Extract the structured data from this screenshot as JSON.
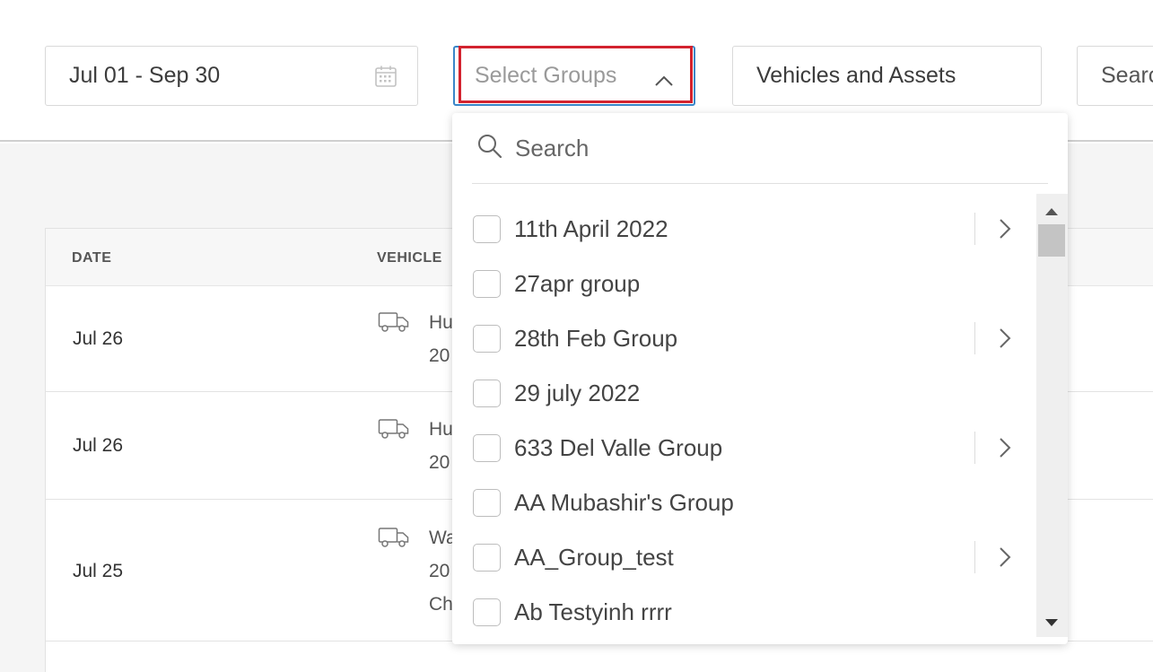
{
  "filters": {
    "date_range": "Jul 01 - Sep 30",
    "groups_placeholder": "Select Groups",
    "vehicles_placeholder": "Vehicles and Assets",
    "search_placeholder": "Search"
  },
  "table": {
    "headers": [
      "DATE",
      "VEHICLE"
    ],
    "rows": [
      {
        "date": "Jul 26",
        "vehicle_line1": "Hu",
        "vehicle_line2": "20",
        "vehicle_line3": ""
      },
      {
        "date": "Jul 26",
        "vehicle_line1": "Hu",
        "vehicle_line2": "20",
        "vehicle_line3": ""
      },
      {
        "date": "Jul 25",
        "vehicle_line1": "Wa",
        "vehicle_line2": "20",
        "vehicle_line3": "Ch"
      }
    ]
  },
  "dropdown": {
    "search_placeholder": "Search",
    "items": [
      {
        "label": "11th April 2022",
        "has_children": true
      },
      {
        "label": "27apr group",
        "has_children": false
      },
      {
        "label": "28th Feb Group",
        "has_children": true
      },
      {
        "label": "29 july 2022",
        "has_children": false
      },
      {
        "label": "633 Del Valle Group",
        "has_children": true
      },
      {
        "label": "AA Mubashir's Group",
        "has_children": false
      },
      {
        "label": "AA_Group_test",
        "has_children": true
      },
      {
        "label": "Ab Testyinh rrrr",
        "has_children": false
      }
    ]
  },
  "colors": {
    "focus_border": "#3a86c8",
    "highlight": "#d3232f"
  }
}
